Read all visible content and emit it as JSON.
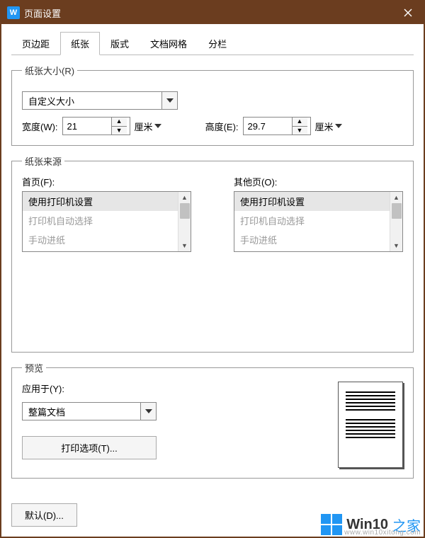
{
  "window": {
    "title": "页面设置"
  },
  "tabs": {
    "items": [
      "页边距",
      "纸张",
      "版式",
      "文档网格",
      "分栏"
    ],
    "active_index": 1
  },
  "paper_size": {
    "legend": "纸张大小(R)",
    "selected": "自定义大小",
    "width_label": "宽度(W):",
    "width_value": "21",
    "height_label": "高度(E):",
    "height_value": "29.7",
    "unit": "厘米"
  },
  "paper_source": {
    "legend": "纸张来源",
    "first_page_label": "首页(F):",
    "other_pages_label": "其他页(O):",
    "options": [
      {
        "label": "使用打印机设置",
        "selected": true,
        "disabled": false
      },
      {
        "label": "打印机自动选择",
        "selected": false,
        "disabled": true
      },
      {
        "label": "手动进纸",
        "selected": false,
        "disabled": true
      }
    ]
  },
  "preview": {
    "legend": "预览",
    "apply_to_label": "应用于(Y):",
    "apply_to_value": "整篇文档",
    "print_options_label": "打印选项(T)..."
  },
  "footer": {
    "default_btn": "默认(D)..."
  },
  "watermark": {
    "brand1": "Win10",
    "brand2": "之家",
    "url": "www.win10xitong.com"
  }
}
